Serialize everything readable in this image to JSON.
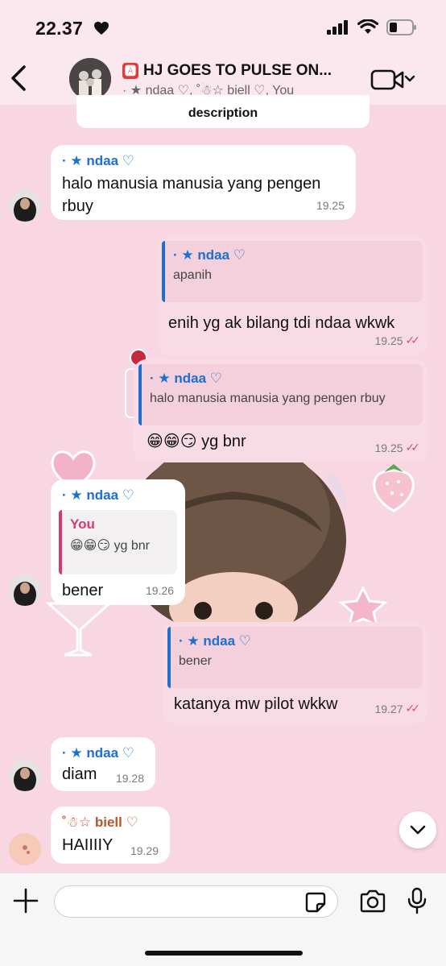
{
  "status_bar": {
    "time": "22.37"
  },
  "header": {
    "group_badge": "🅰",
    "group_name": "HJ GOES TO PULSE ON...",
    "members": "· ★ ndaa ♡, ˚☃︎☆ biell ♡, You"
  },
  "description_label": "description",
  "messages": [
    {
      "sender": "· ★ ndaa ♡",
      "text": "halo manusia manusia yang pengen rbuy",
      "time": "19.25"
    },
    {
      "quote_sender": "· ★ ndaa ♡",
      "quote_text": "apanih",
      "text": "enih yg ak bilang tdi ndaa wkwk",
      "time": "19.25"
    },
    {
      "quote_sender": "· ★ ndaa ♡",
      "quote_text": "halo manusia manusia yang pengen rbuy",
      "text": "😁😁😏 yg bnr",
      "time": "19.25"
    },
    {
      "sender": "· ★ ndaa ♡",
      "quote_sender": "You",
      "quote_text": "😁😁😏 yg bnr",
      "text": "bener",
      "time": "19.26"
    },
    {
      "quote_sender": "· ★ ndaa ♡",
      "quote_text": "bener",
      "text": "katanya mw pilot wkkw",
      "time": "19.27"
    },
    {
      "sender": "· ★ ndaa ♡",
      "text": "diam",
      "time": "19.28"
    },
    {
      "sender": "˚☃︎☆ biell ♡",
      "text": "HAIIIIY",
      "time": "19.29"
    }
  ],
  "colors": {
    "background": "#f9d7e2",
    "outgoing": "#f8dbe5",
    "incoming": "#ffffff",
    "ndaa": "#1e6fd0",
    "you": "#d13a76",
    "biell": "#c0522d",
    "read_ticks": "#d4507a"
  },
  "icons": [
    "back-chevron-icon",
    "video-call-icon",
    "chevron-down-icon",
    "plus-icon",
    "sticker-icon",
    "camera-icon",
    "microphone-icon"
  ]
}
